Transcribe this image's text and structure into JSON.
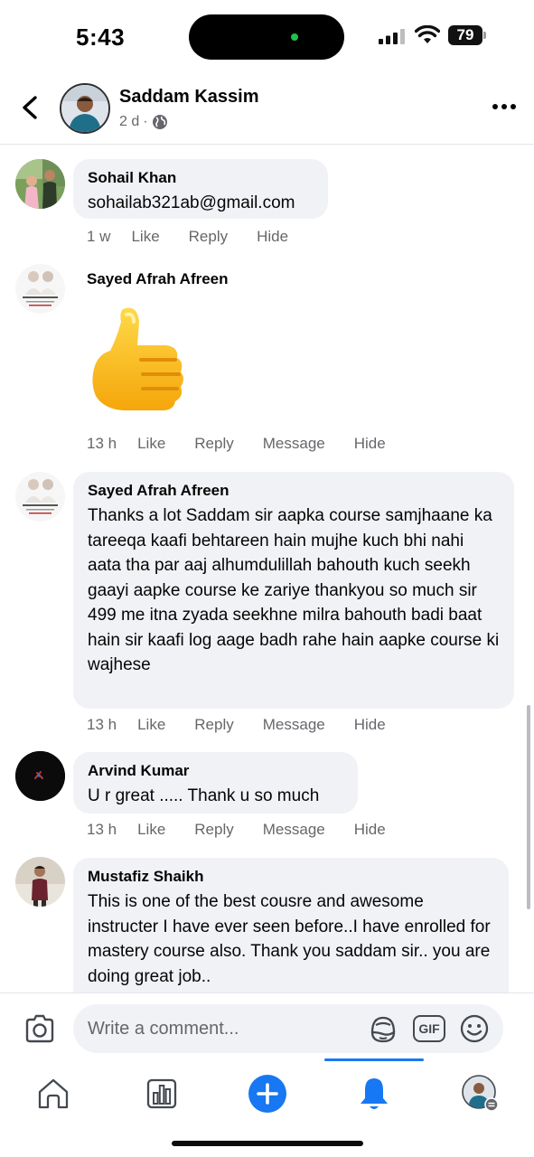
{
  "status_bar": {
    "time": "5:43",
    "battery": "79"
  },
  "post_header": {
    "author": "Saddam Kassim",
    "age": "2 d",
    "separator": "·"
  },
  "comments": [
    {
      "name": "Sohail Khan",
      "text": "sohailab321ab@gmail.com",
      "time": "1 w",
      "actions": [
        "Like",
        "Reply",
        "Hide"
      ]
    },
    {
      "name": "Sayed Afrah Afreen",
      "sticker": "thumbs-up",
      "time": "13 h",
      "actions": [
        "Like",
        "Reply",
        "Message",
        "Hide"
      ]
    },
    {
      "name": "Sayed Afrah Afreen",
      "text": "Thanks a lot Saddam sir aapka course samjhaane ka tareeqa kaafi behtareen hain mujhe kuch bhi nahi aata tha par aaj alhumdulillah bahouth kuch seekh gaayi aapke course ke zariye thankyou so much sir 499 me itna zyada seekhne milra bahouth badi baat hain sir kaafi log aage badh rahe hain aapke course ki wajhese",
      "time": "13 h",
      "actions": [
        "Like",
        "Reply",
        "Message",
        "Hide"
      ]
    },
    {
      "name": "Arvind Kumar",
      "text": "U r great ..... Thank u so much",
      "time": "13 h",
      "actions": [
        "Like",
        "Reply",
        "Message",
        "Hide"
      ]
    },
    {
      "name": "Mustafiz Shaikh",
      "text": "This is one of the best cousre and awesome instructer I have ever seen before..I have enrolled for mastery course also. Thank you saddam sir.. you are doing great job.."
    }
  ],
  "composer": {
    "placeholder": "Write a comment...",
    "gif_label": "GIF"
  },
  "tabbar": {
    "active_tab": "notifications",
    "tabs": [
      "home",
      "dashboard",
      "create",
      "notifications",
      "profile"
    ]
  },
  "colors": {
    "accent": "#1877f2",
    "bubble": "#f0f2f5",
    "meta_text": "#65676b"
  }
}
